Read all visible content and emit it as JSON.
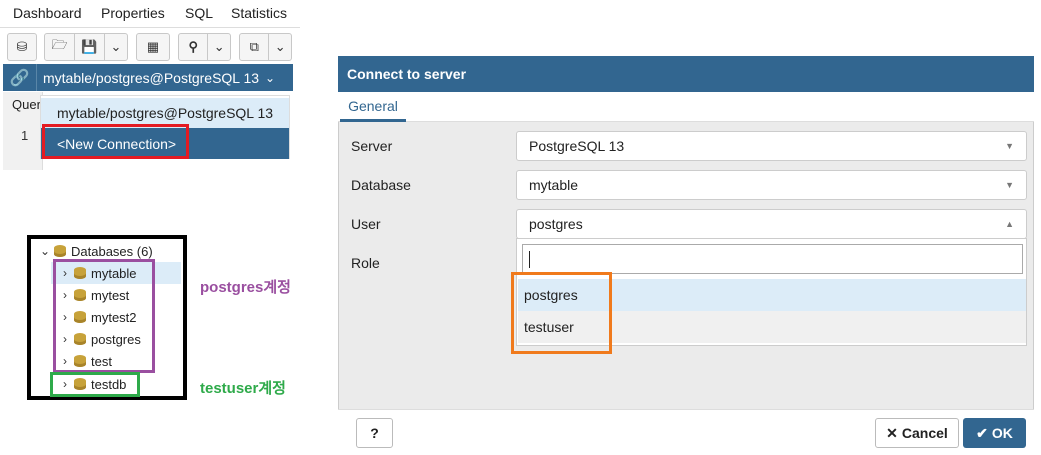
{
  "menu": {
    "tabs": [
      "Dashboard",
      "Properties",
      "SQL",
      "Statistics"
    ]
  },
  "toolbar": {
    "connection": "mytable/postgres@PostgreSQL 13"
  },
  "query_panel": {
    "tab_partial": "Quer",
    "line_number": "1"
  },
  "connection_dropdown": {
    "items": [
      "mytable/postgres@PostgreSQL 13",
      "<New Connection>"
    ]
  },
  "tree": {
    "root": "Databases (6)",
    "items": [
      "mytable",
      "mytest",
      "mytest2",
      "postgres",
      "test",
      "testdb"
    ]
  },
  "annotations": {
    "postgres_group": "postgres계정",
    "testuser_group": "testuser계정"
  },
  "dialog": {
    "title": "Connect to server",
    "tab": "General",
    "fields": {
      "server_label": "Server",
      "server_value": "PostgreSQL 13",
      "database_label": "Database",
      "database_value": "mytable",
      "user_label": "User",
      "user_value": "postgres",
      "role_label": "Role"
    },
    "user_options": [
      "postgres",
      "testuser"
    ],
    "help_label": "?",
    "cancel_label": "Cancel",
    "ok_label": "OK"
  },
  "colors": {
    "header": "#326690",
    "highlight_red": "#e31b23",
    "highlight_orange": "#f07a1c",
    "box_purple": "#9a4fa0",
    "box_green": "#2eaa4a",
    "ok_button": "#326690"
  }
}
